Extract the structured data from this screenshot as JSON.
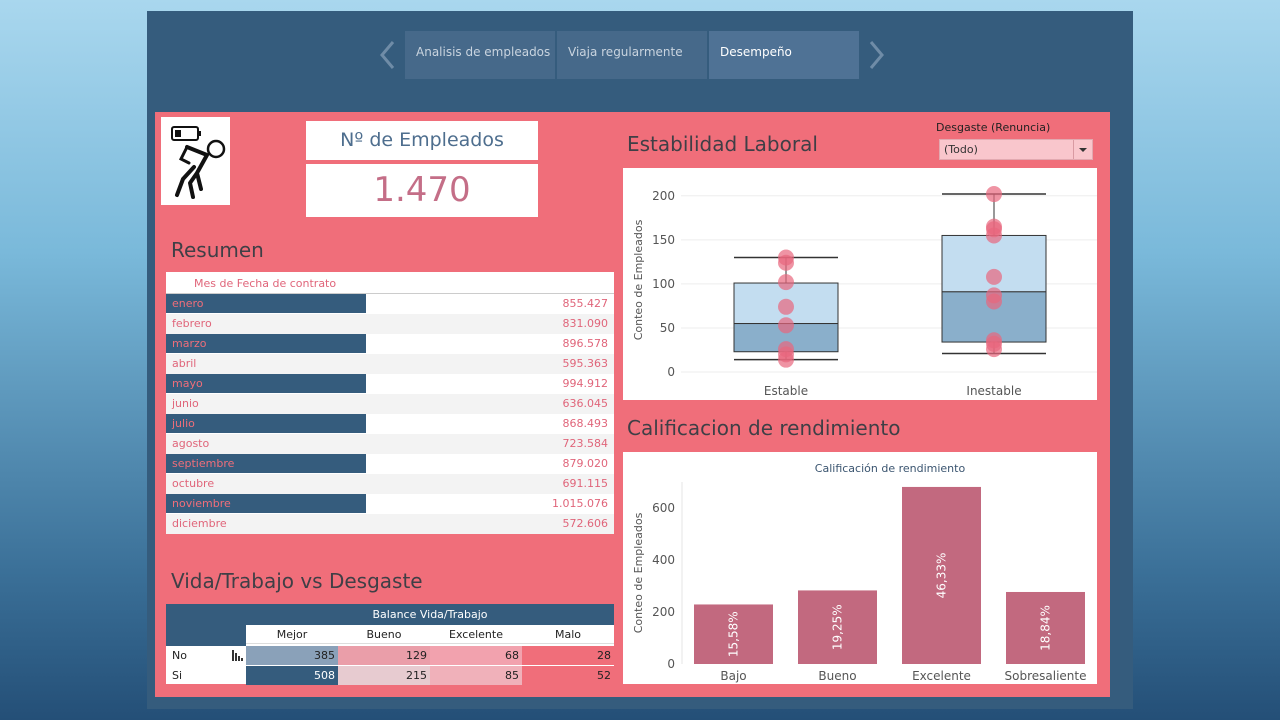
{
  "tabs": [
    {
      "label": "Analisis de empleados"
    },
    {
      "label": "Viaja regularmente"
    },
    {
      "label": "Desempeño"
    }
  ],
  "kpi": {
    "label": "Nº de Empleados",
    "value": "1.470"
  },
  "summary": {
    "title": "Resumen",
    "column_header": "Mes de Fecha de contrato",
    "rows": [
      {
        "month": "enero",
        "value": "855.427"
      },
      {
        "month": "febrero",
        "value": "831.090"
      },
      {
        "month": "marzo",
        "value": "896.578"
      },
      {
        "month": "abril",
        "value": "595.363"
      },
      {
        "month": "mayo",
        "value": "994.912"
      },
      {
        "month": "junio",
        "value": "636.045"
      },
      {
        "month": "julio",
        "value": "868.493"
      },
      {
        "month": "agosto",
        "value": "723.584"
      },
      {
        "month": "septiembre",
        "value": "879.020"
      },
      {
        "month": "octubre",
        "value": "691.115"
      },
      {
        "month": "noviembre",
        "value": "1.015.076"
      },
      {
        "month": "diciembre",
        "value": "572.606"
      }
    ]
  },
  "filter": {
    "label": "Desgaste (Renuncia)",
    "value": "(Todo)"
  },
  "stability": {
    "title": "Estabilidad Laboral"
  },
  "performance": {
    "title": "Calificacion de rendimiento"
  },
  "heatmap": {
    "title": "Vida/Trabajo vs Desgaste",
    "header": "Balance Vida/Trabajo",
    "columns": [
      "Mejor",
      "Bueno",
      "Excelente",
      "Malo"
    ],
    "rows": [
      {
        "label": "No",
        "values": [
          385,
          129,
          68,
          28
        ]
      },
      {
        "label": "Si",
        "values": [
          508,
          215,
          85,
          52
        ]
      }
    ],
    "colors": [
      [
        "#8aa1b9",
        "#ea9ea9",
        "#f2a2ae",
        "#f06e7a"
      ],
      [
        "#355c7d",
        "#e7cbd0",
        "#f0b1ba",
        "#f06e7a"
      ]
    ]
  },
  "chart_data": [
    {
      "type": "box",
      "title": "",
      "xlabel": "",
      "ylabel": "Conteo de Empleados",
      "categories": [
        "Estable",
        "Inestable"
      ],
      "ylim": [
        0,
        210
      ],
      "yticks": [
        0,
        50,
        100,
        150,
        200
      ],
      "boxes": [
        {
          "category": "Estable",
          "min": 14,
          "q1": 23,
          "median": 55,
          "q3": 101,
          "max": 130
        },
        {
          "category": "Inestable",
          "min": 21,
          "q1": 34,
          "median": 91,
          "q3": 155,
          "max": 202
        }
      ],
      "points": [
        {
          "category": "Estable",
          "values": [
            14,
            20,
            26,
            53,
            74,
            102,
            124,
            130
          ]
        },
        {
          "category": "Inestable",
          "values": [
            26,
            32,
            36,
            80,
            87,
            108,
            155,
            162,
            165,
            202
          ]
        }
      ],
      "colors": {
        "box_upper": "#c3ddf0",
        "box_lower": "#8aafcb",
        "points": "#e8677d"
      }
    },
    {
      "type": "bar",
      "title": "Calificación de rendimiento",
      "xlabel": "",
      "ylabel": "Conteo de Empleados",
      "categories": [
        "Bajo",
        "Bueno",
        "Excelente",
        "Sobresaliente"
      ],
      "values": [
        229,
        283,
        681,
        277
      ],
      "labels": [
        "15,58%",
        "19,25%",
        "46,33%",
        "18,84%"
      ],
      "ylim": [
        0,
        700
      ],
      "yticks": [
        0,
        200,
        400,
        600
      ],
      "color": "#c2697f"
    }
  ]
}
